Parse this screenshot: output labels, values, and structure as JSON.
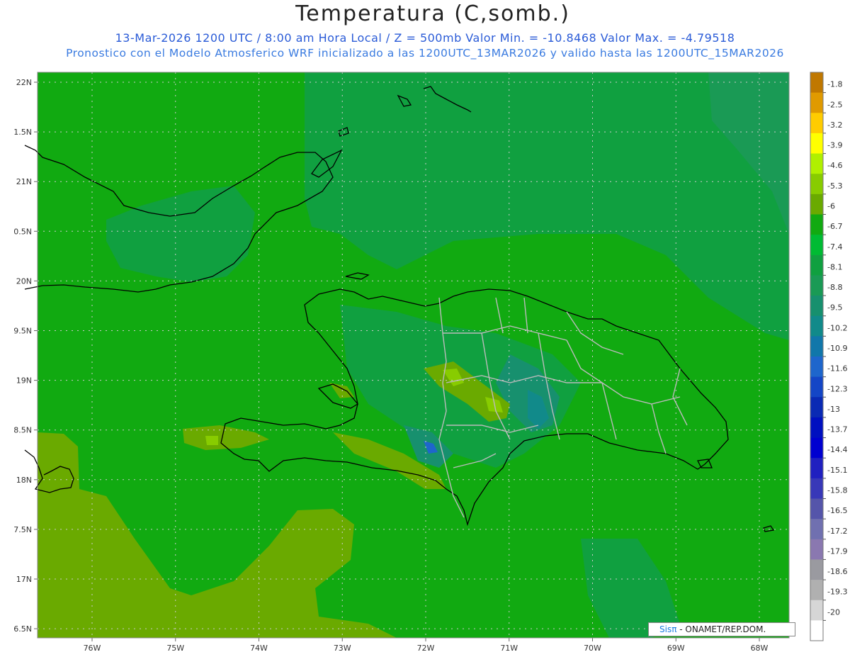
{
  "header": {
    "title": "Temperatura (C,somb.)",
    "line1": "13-Mar-2026   1200 UTC / 8:00 am Hora Local / Z = 500mb   Valor Min. = -10.8468   Valor Max. = -4.79518",
    "line2": "Pronostico con el Modelo Atmosferico WRF inicializado a las 1200UTC_13MAR2026 y valido hasta las  1200UTC_15MAR2026"
  },
  "map": {
    "lat_labels": [
      "22N",
      "1.5N",
      "21N",
      "0.5N",
      "20N",
      "9.5N",
      "19N",
      "8.5N",
      "18N",
      "7.5N",
      "17N",
      "6.5N"
    ],
    "lon_labels": [
      "76W",
      "75W",
      "74W",
      "73W",
      "72W",
      "71W",
      "70W",
      "69W",
      "68W"
    ],
    "lat_values": [
      22,
      21.5,
      21,
      20.5,
      20,
      19.5,
      19,
      18.5,
      18,
      17.5,
      17,
      16.5
    ],
    "lon_values": [
      -76,
      -75,
      -74,
      -73,
      -72,
      -71,
      -70,
      -69,
      -68
    ]
  },
  "colorbar": {
    "labels": [
      "-1.8",
      "-2.5",
      "-3.2",
      "-3.9",
      "-4.6",
      "-5.3",
      "-6",
      "-6.7",
      "-7.4",
      "-8.1",
      "-8.8",
      "-9.5",
      "-10.2",
      "-10.9",
      "-11.6",
      "-12.3",
      "-13",
      "-13.7",
      "-14.4",
      "-15.1",
      "-15.8",
      "-16.5",
      "-17.2",
      "-17.9",
      "-18.6",
      "-19.3",
      "-20"
    ],
    "colors": [
      "#c07800",
      "#e09a00",
      "#ffcc00",
      "#ffff00",
      "#b0f000",
      "#88cc00",
      "#6aaa00",
      "#11aa11",
      "#00bb33",
      "#10a040",
      "#1a9a55",
      "#17906e",
      "#118a8a",
      "#1177aa",
      "#1e66cc",
      "#1446c6",
      "#0a2ab4",
      "#0010c0",
      "#0000d0",
      "#2020c0",
      "#3838b8",
      "#5555aa",
      "#7070b0",
      "#8a78b0",
      "#9a9aa0",
      "#b0b0b0",
      "#d6d6d6",
      "#ffffff"
    ]
  },
  "credit": {
    "brand": "Sisπ",
    "text": " - ONAMET/REP.DOM."
  }
}
